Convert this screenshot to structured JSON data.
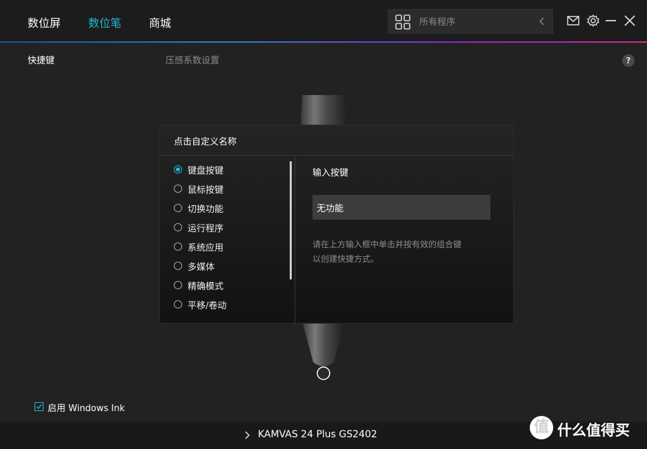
{
  "nav": {
    "tabs": [
      {
        "label": "数位屏"
      },
      {
        "label": "数位笔"
      },
      {
        "label": "商城"
      }
    ],
    "active_color": "#21b8d6"
  },
  "search": {
    "placeholder": "所有程序"
  },
  "window_icons": [
    "mail-icon",
    "gear-icon",
    "minimize-icon",
    "close-icon"
  ],
  "subtabs": {
    "shortcut": "快捷键",
    "pressure": "压感系数设置"
  },
  "help": {
    "label": "?"
  },
  "dialog": {
    "title": "点击自定义名称",
    "options": [
      {
        "label": "键盘按键",
        "checked": true
      },
      {
        "label": "鼠标按键",
        "checked": false
      },
      {
        "label": "切换功能",
        "checked": false
      },
      {
        "label": "运行程序",
        "checked": false
      },
      {
        "label": "系统应用",
        "checked": false
      },
      {
        "label": "多媒体",
        "checked": false
      },
      {
        "label": "精确模式",
        "checked": false
      },
      {
        "label": "平移/卷动",
        "checked": false
      }
    ],
    "right_title": "输入按键",
    "key_value": "无功能",
    "hint_line1": "请在上方输入框中单击并按有效的组合键",
    "hint_line2": "以创建快捷方式。"
  },
  "windows_ink": {
    "label": "启用 Windows Ink",
    "checked": true
  },
  "footer": {
    "device": "KAMVAS 24 Plus GS2402"
  },
  "watermark": {
    "logo_text": "值",
    "text": "什么值得买"
  }
}
